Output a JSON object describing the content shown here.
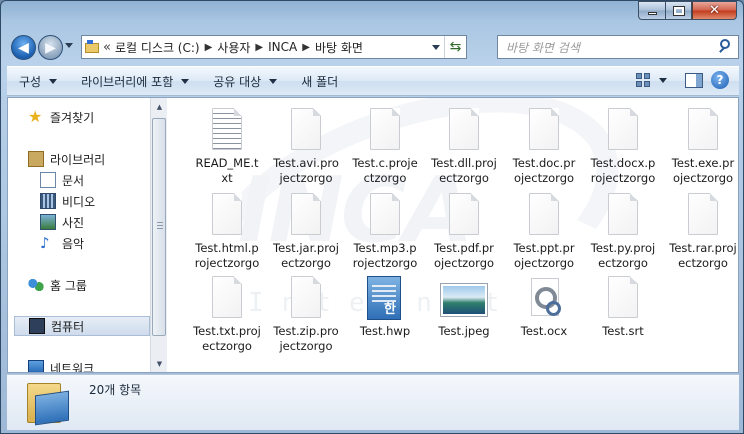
{
  "window": {
    "min_icon": "minimize-icon",
    "max_icon": "maximize-icon",
    "close_glyph": "✕"
  },
  "nav": {
    "back_glyph": "◀",
    "forward_glyph": "▶",
    "breadcrumb_prefix": "«",
    "breadcrumb": [
      "로컬 디스크 (C:)",
      "사용자",
      "INCA",
      "바탕 화면"
    ],
    "refresh_glyph": "⇆",
    "search_placeholder": "바탕 화면 검색"
  },
  "toolbar": {
    "organize": "구성",
    "include_library": "라이브러리에 포함",
    "share_with": "공유 대상",
    "new_folder": "새 폴더",
    "help_glyph": "?"
  },
  "sidebar": {
    "favorites": "즐겨찾기",
    "libraries": "라이브러리",
    "documents": "문서",
    "videos": "비디오",
    "pictures": "사진",
    "music": "음악",
    "homegroup": "홈 그룹",
    "computer": "컴퓨터",
    "network": "네트워크"
  },
  "watermark": {
    "logo": "INCA",
    "sub": "Internet"
  },
  "files": [
    {
      "name": "READ_ME.t\nxt",
      "icon": "text-icon"
    },
    {
      "name": "Test.avi.pro\njectzorgo",
      "icon": "blank-icon"
    },
    {
      "name": "Test.c.proje\nctzorgo",
      "icon": "blank-icon"
    },
    {
      "name": "Test.dll.proj\nectzorgo",
      "icon": "blank-icon"
    },
    {
      "name": "Test.doc.pr\nojectzorgo",
      "icon": "blank-icon"
    },
    {
      "name": "Test.docx.p\nrojectzorgo",
      "icon": "blank-icon"
    },
    {
      "name": "Test.exe.pr\nojectzorgo",
      "icon": "blank-icon"
    },
    {
      "name": "Test.html.p\nrojectzorgo",
      "icon": "blank-icon"
    },
    {
      "name": "Test.jar.proj\nectzorgo",
      "icon": "blank-icon"
    },
    {
      "name": "Test.mp3.p\nrojectzorgo",
      "icon": "blank-icon"
    },
    {
      "name": "Test.pdf.pr\nojectzorgo",
      "icon": "blank-icon"
    },
    {
      "name": "Test.ppt.pr\nojectzorgo",
      "icon": "blank-icon"
    },
    {
      "name": "Test.py.proj\nectzorgo",
      "icon": "blank-icon"
    },
    {
      "name": "Test.rar.proj\nectzorgo",
      "icon": "blank-icon"
    },
    {
      "name": "Test.txt.proj\nectzorgo",
      "icon": "blank-icon"
    },
    {
      "name": "Test.zip.pro\njectzorgo",
      "icon": "blank-icon"
    },
    {
      "name": "Test.hwp",
      "icon": "hwp-icon"
    },
    {
      "name": "Test.jpeg",
      "icon": "image-icon"
    },
    {
      "name": "Test.ocx",
      "icon": "gear-file-icon"
    },
    {
      "name": "Test.srt",
      "icon": "blank-icon"
    }
  ],
  "status": {
    "item_count": "20개 항목"
  }
}
